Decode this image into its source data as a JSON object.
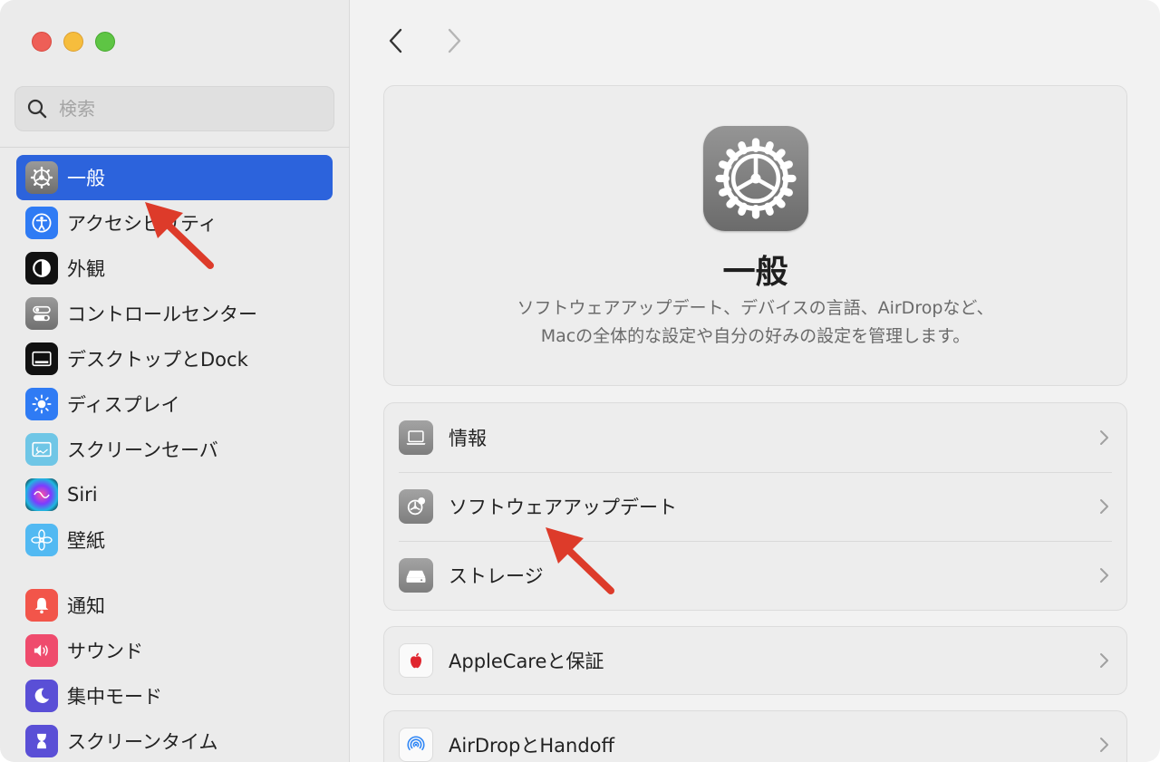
{
  "search": {
    "placeholder": "検索"
  },
  "sidebar": {
    "items": [
      {
        "label": "一般",
        "icon": "gear-icon",
        "active": true
      },
      {
        "label": "アクセシビリティ",
        "icon": "accessibility-icon"
      },
      {
        "label": "外観",
        "icon": "appearance-icon"
      },
      {
        "label": "コントロールセンター",
        "icon": "control-center-icon"
      },
      {
        "label": "デスクトップとDock",
        "icon": "desktop-dock-icon"
      },
      {
        "label": "ディスプレイ",
        "icon": "display-brightness-icon"
      },
      {
        "label": "スクリーンセーバ",
        "icon": "screensaver-icon"
      },
      {
        "label": "Siri",
        "icon": "siri-icon"
      },
      {
        "label": "壁紙",
        "icon": "wallpaper-flower-icon"
      },
      {
        "label": "通知",
        "icon": "notification-bell-icon"
      },
      {
        "label": "サウンド",
        "icon": "speaker-icon"
      },
      {
        "label": "集中モード",
        "icon": "moon-icon"
      },
      {
        "label": "スクリーンタイム",
        "icon": "hourglass-icon"
      }
    ]
  },
  "hero": {
    "title": "一般",
    "desc_line1": "ソフトウェアアップデート、デバイスの言語、AirDropなど、",
    "desc_line2": "Macの全体的な設定や自分の好みの設定を管理します。"
  },
  "cards": [
    {
      "rows": [
        {
          "label": "情報",
          "icon": "laptop-icon"
        },
        {
          "label": "ソフトウェアアップデート",
          "icon": "gear-badge-icon"
        },
        {
          "label": "ストレージ",
          "icon": "storage-drive-icon"
        }
      ]
    },
    {
      "rows": [
        {
          "label": "AppleCareと保証",
          "icon": "apple-logo-icon"
        }
      ]
    },
    {
      "rows": [
        {
          "label": "AirDropとHandoff",
          "icon": "airdrop-icon"
        }
      ]
    }
  ],
  "colors": {
    "accent": "#2c63dc",
    "annotation_arrow": "#dd3b2a"
  }
}
